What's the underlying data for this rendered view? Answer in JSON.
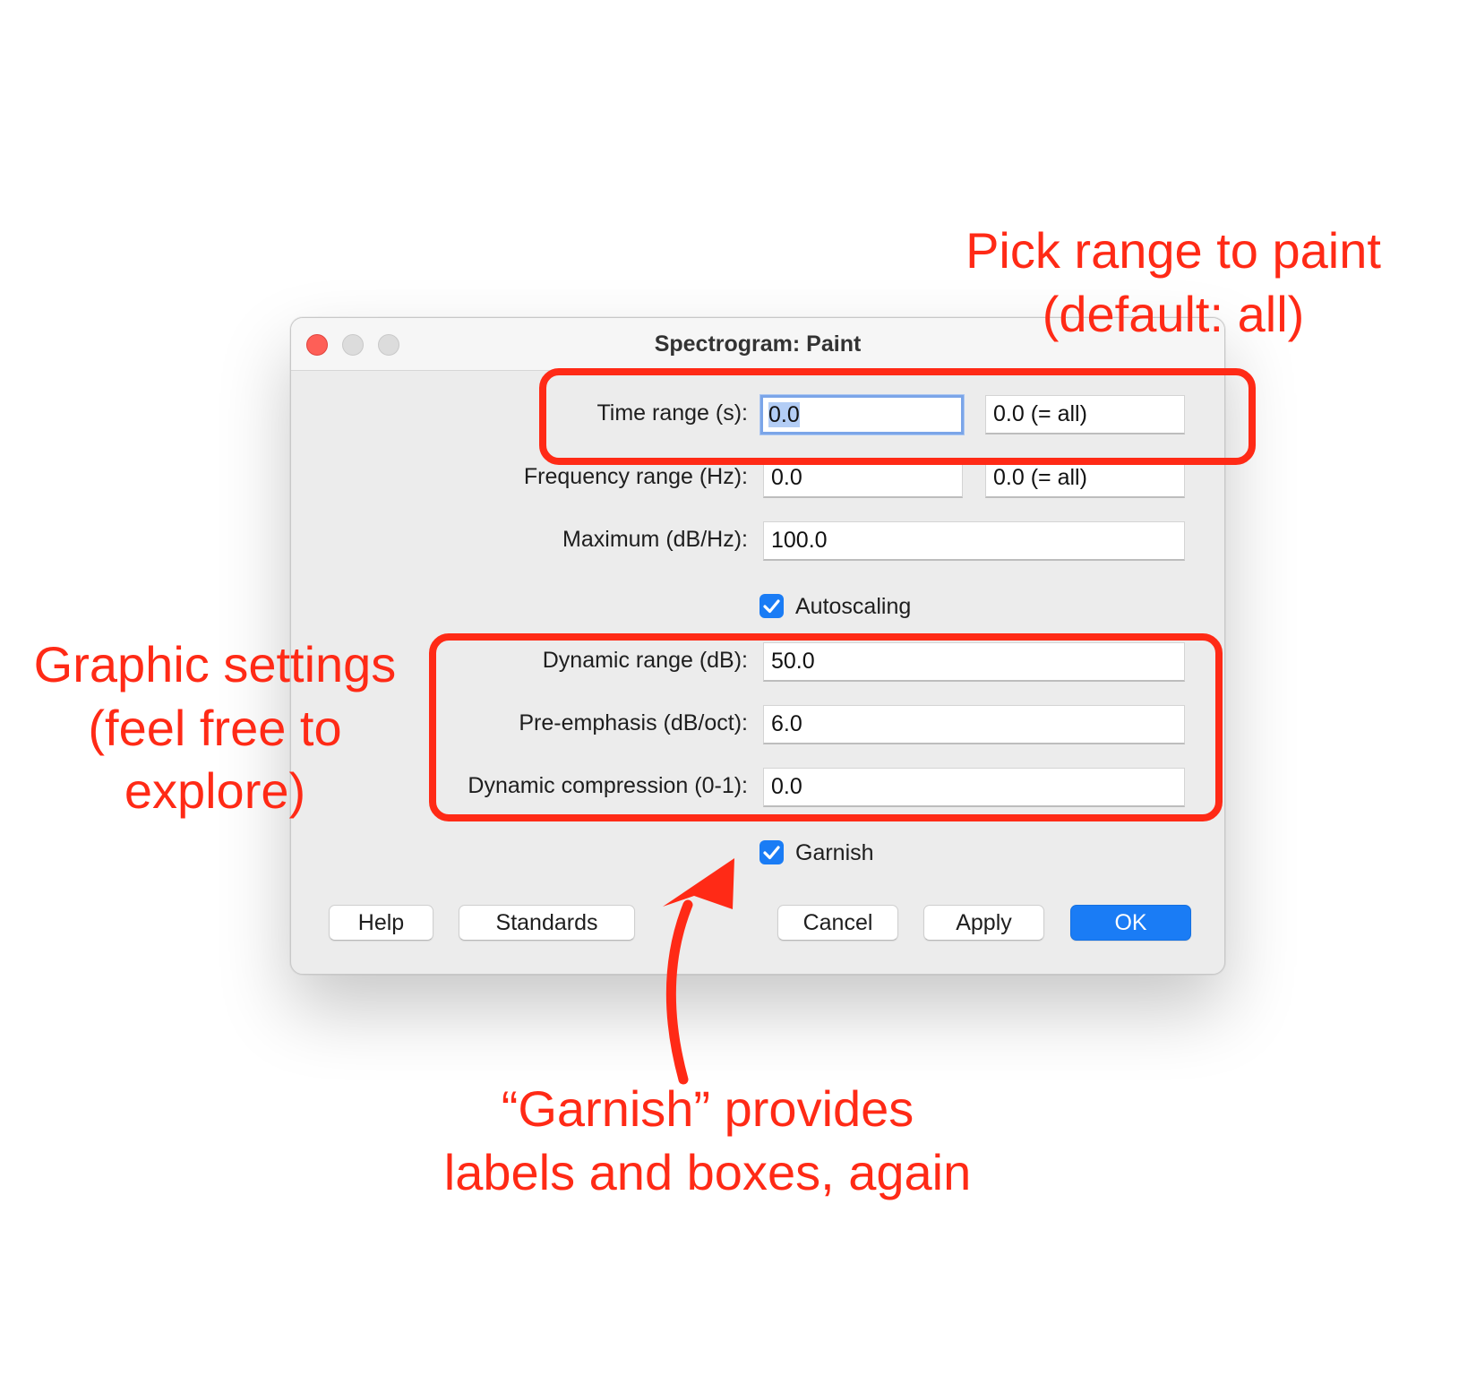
{
  "window": {
    "title": "Spectrogram: Paint"
  },
  "form": {
    "time_range": {
      "label": "Time range (s):",
      "from": "0.0",
      "to": "0.0 (= all)"
    },
    "frequency_range": {
      "label": "Frequency range (Hz):",
      "from": "0.0",
      "to": "0.0 (= all)"
    },
    "maximum": {
      "label": "Maximum (dB/Hz):",
      "value": "100.0"
    },
    "autoscaling": {
      "label": "Autoscaling",
      "checked": true
    },
    "dynamic_range": {
      "label": "Dynamic range (dB):",
      "value": "50.0"
    },
    "pre_emphasis": {
      "label": "Pre-emphasis (dB/oct):",
      "value": "6.0"
    },
    "dynamic_compression": {
      "label": "Dynamic compression (0-1):",
      "value": "0.0"
    },
    "garnish": {
      "label": "Garnish",
      "checked": true
    }
  },
  "buttons": {
    "help": "Help",
    "standards": "Standards",
    "cancel": "Cancel",
    "apply": "Apply",
    "ok": "OK"
  },
  "annotations": {
    "range": {
      "line1": "Pick range to paint",
      "line2": "(default: all)"
    },
    "graphic": {
      "line1": "Graphic settings",
      "line2": "(feel free to",
      "line3": "explore)"
    },
    "garnish": {
      "line1": "“Garnish” provides",
      "line2": "labels and boxes, again"
    }
  },
  "colors": {
    "annotation_red": "#ff2a16",
    "accent_blue": "#1a7cf5",
    "close_red": "#fe5f57"
  }
}
